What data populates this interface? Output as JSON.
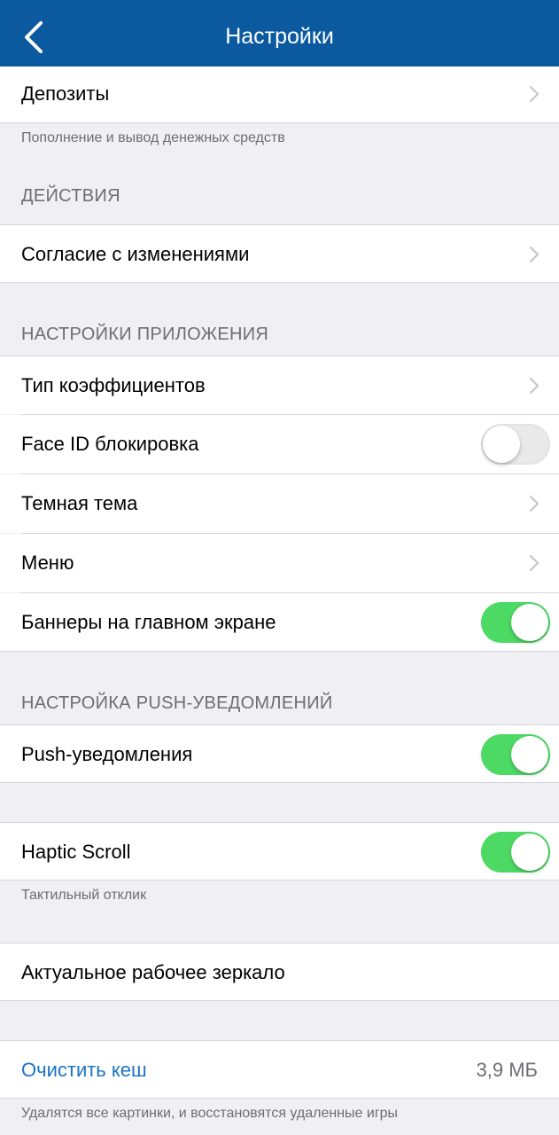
{
  "nav": {
    "title": "Настройки"
  },
  "deposits": {
    "label": "Депозиты",
    "footer": "Пополнение и вывод денежных средств"
  },
  "actions": {
    "header": "ДЕЙСТВИЯ",
    "consent_label": "Согласие с изменениями"
  },
  "app_settings": {
    "header": "НАСТРОЙКИ ПРИЛОЖЕНИЯ",
    "odds_type_label": "Тип коэффициентов",
    "face_id_label": "Face ID блокировка",
    "face_id_enabled": false,
    "dark_theme_label": "Темная тема",
    "menu_label": "Меню",
    "banners_label": "Баннеры на главном экране",
    "banners_enabled": true
  },
  "push": {
    "header": "НАСТРОЙКА PUSH-УВЕДОМЛЕНИЙ",
    "push_label": "Push-уведомления",
    "push_enabled": true
  },
  "haptic": {
    "label": "Haptic Scroll",
    "enabled": true,
    "footer": "Тактильный отклик"
  },
  "mirror": {
    "label": "Актуальное рабочее зеркало"
  },
  "cache": {
    "label": "Очистить кеш",
    "size": "3,9 МБ",
    "footer": "Удалятся все картинки, и восстановятся удаленные игры"
  },
  "colors": {
    "nav_bg": "#0b5aa0",
    "toggle_on": "#4cd964",
    "link": "#1a73c8"
  },
  "icons": [
    "back-chevron-icon",
    "chevron-right-icon"
  ]
}
